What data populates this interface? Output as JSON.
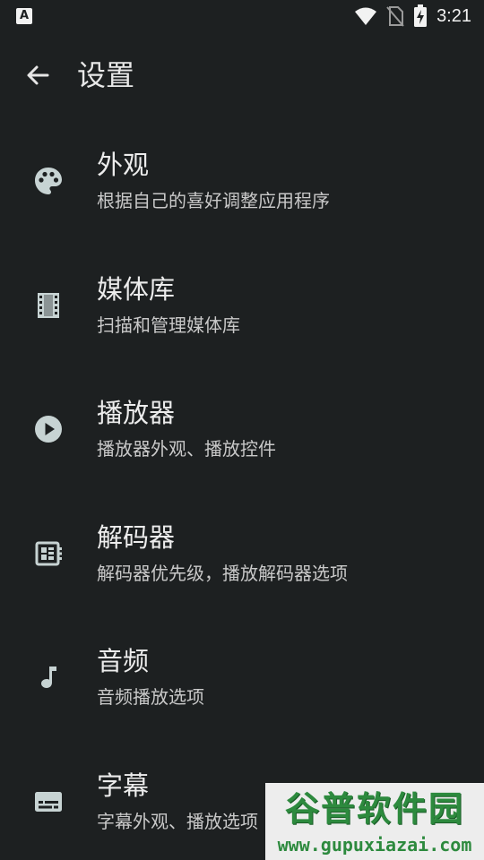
{
  "status_bar": {
    "app_icon_letter": "A",
    "time": "3:21",
    "icons": [
      "wifi-icon",
      "no-sim-icon",
      "battery-charging-icon"
    ]
  },
  "app_bar": {
    "title": "设置",
    "back_icon": "arrow-left-icon"
  },
  "settings": {
    "items": [
      {
        "title": "外观",
        "subtitle": "根据自己的喜好调整应用程序",
        "icon": "palette-icon"
      },
      {
        "title": "媒体库",
        "subtitle": "扫描和管理媒体库",
        "icon": "film-icon"
      },
      {
        "title": "播放器",
        "subtitle": "播放器外观、播放控件",
        "icon": "play-circle-icon"
      },
      {
        "title": "解码器",
        "subtitle": "解码器优先级，播放解码器选项",
        "icon": "chip-icon"
      },
      {
        "title": "音频",
        "subtitle": "音频播放选项",
        "icon": "music-note-icon"
      },
      {
        "title": "字幕",
        "subtitle": "字幕外观、播放选项",
        "icon": "subtitles-icon"
      }
    ]
  },
  "watermark": {
    "logo_text": "谷普软件园",
    "url": "www.gupuxiazai.com"
  },
  "colors": {
    "background": "#1d2021",
    "icon": "#c7d3d3",
    "text_primary": "#ececec",
    "text_secondary": "#c9c9c9"
  }
}
